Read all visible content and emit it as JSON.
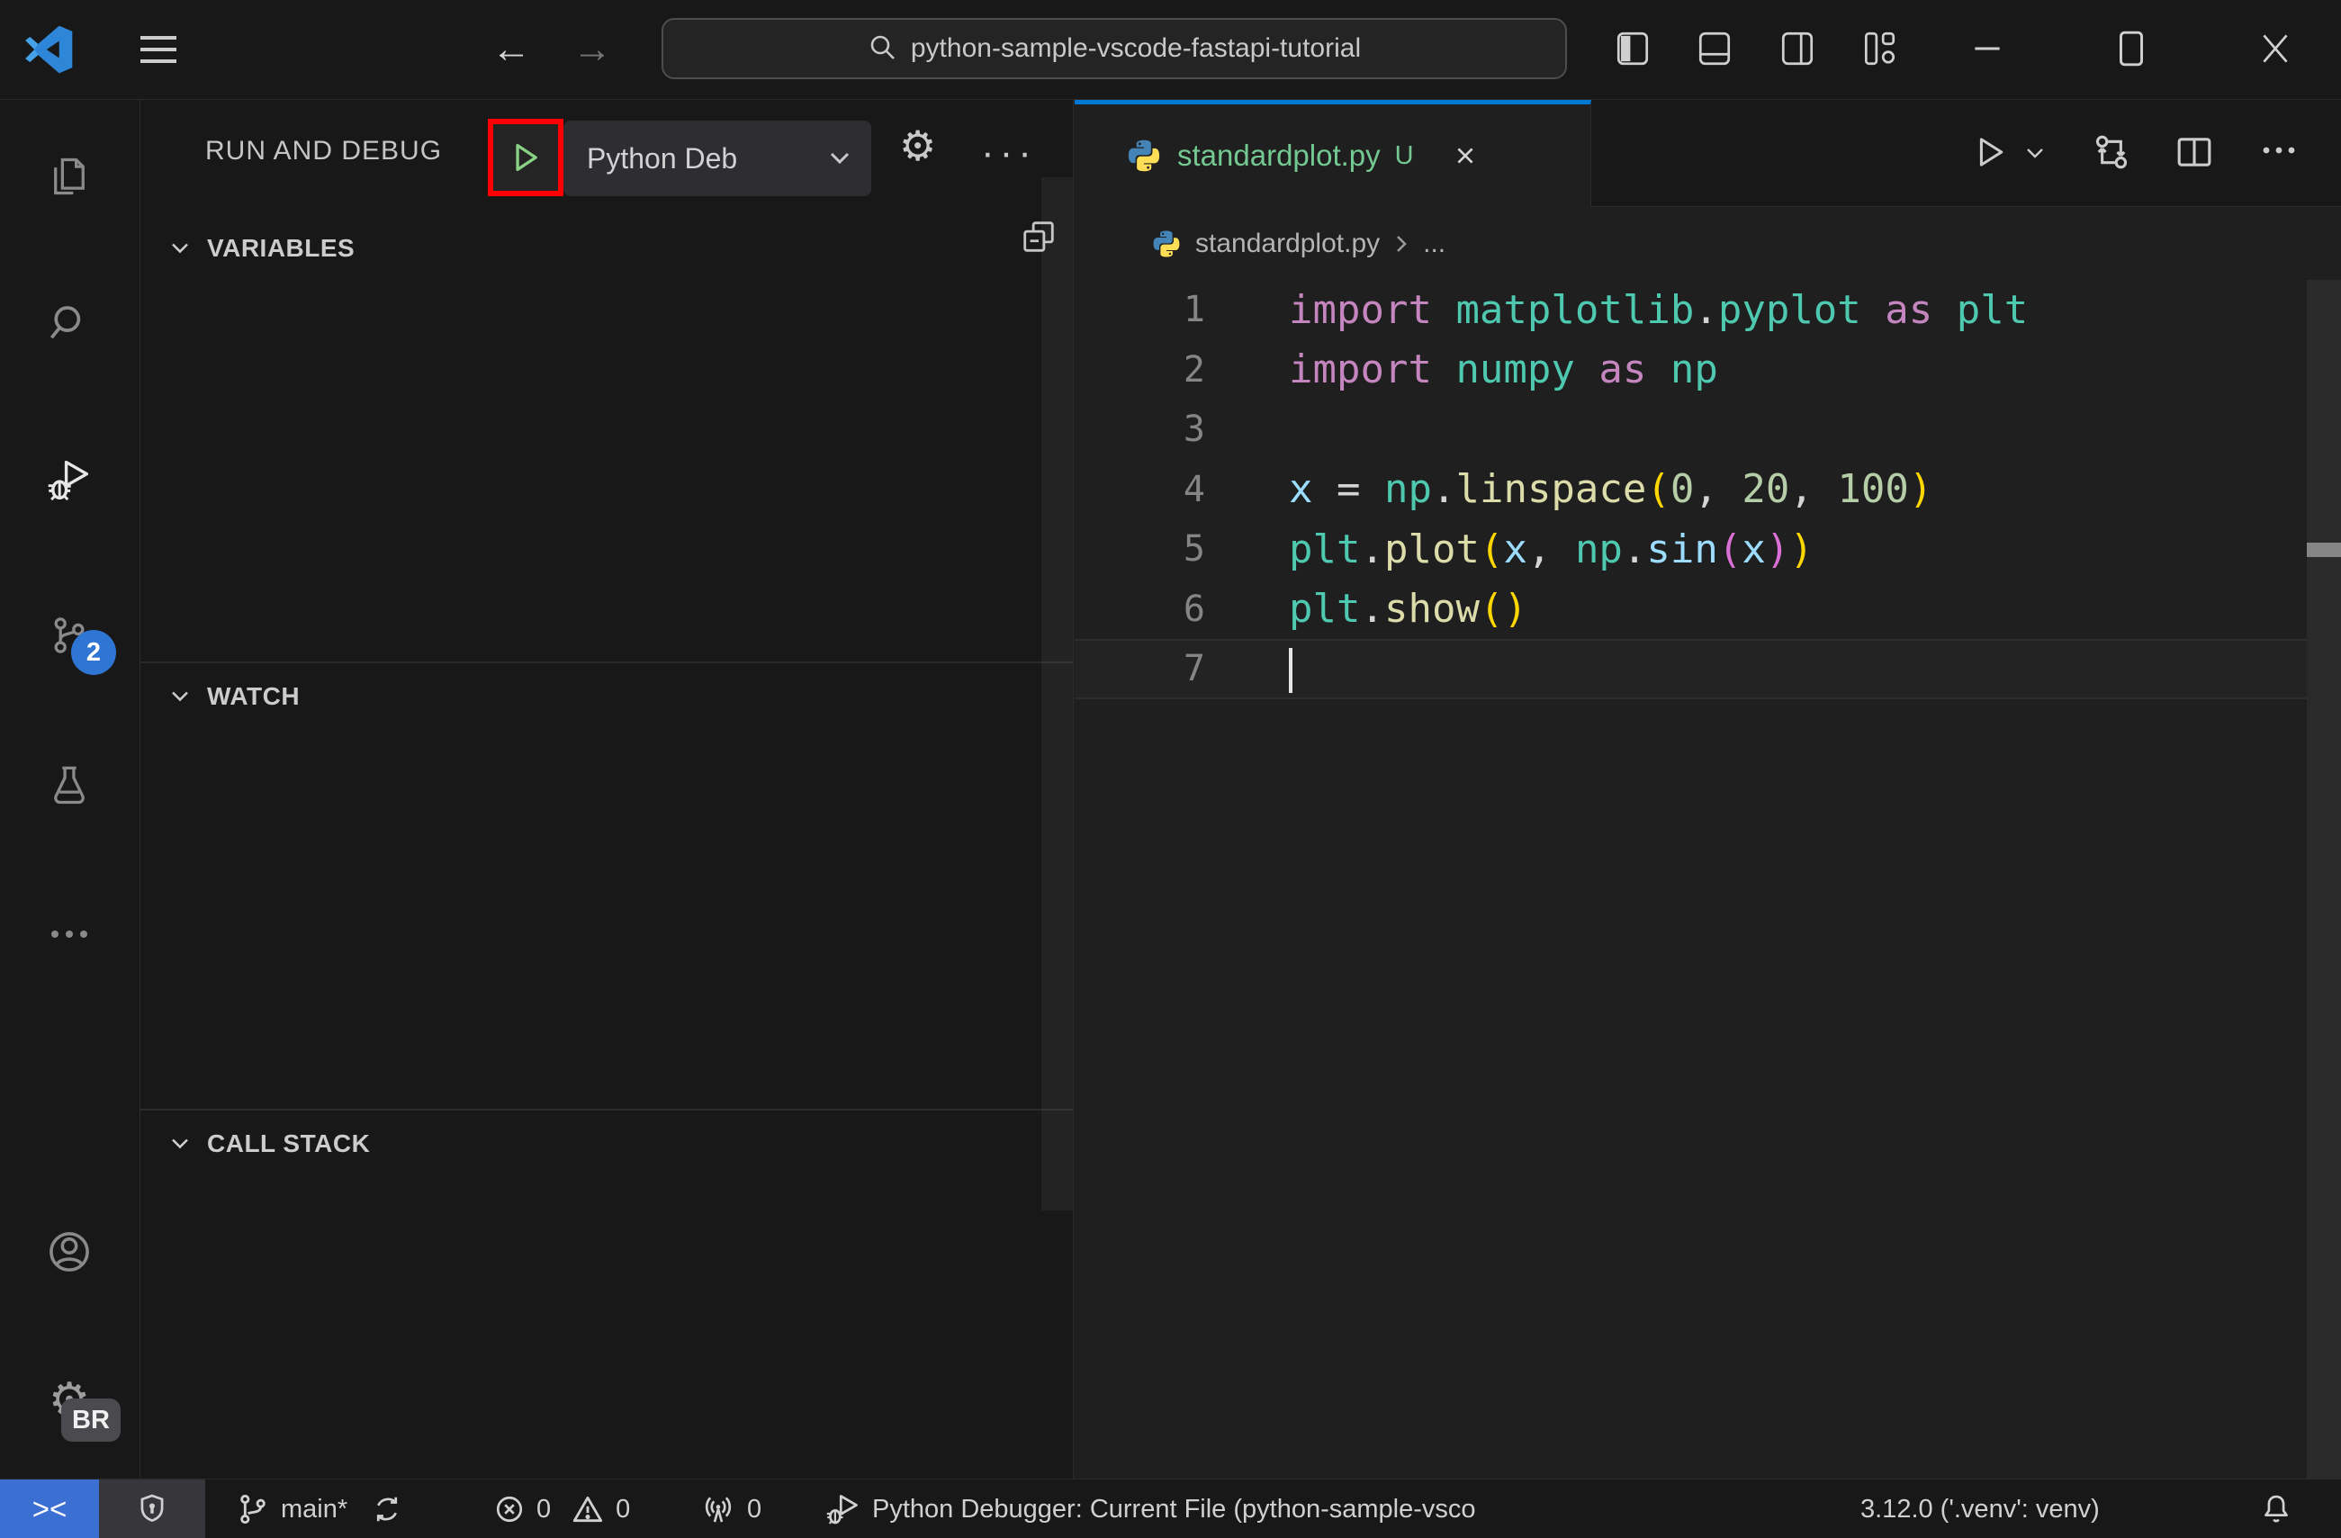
{
  "colors": {
    "accent_blue": "#0078D4",
    "badge_blue": "#2F76D4",
    "remote_blue": "#3C6FD2",
    "untracked_green": "#73C991",
    "play_green": "#89D185",
    "highlight_red": "#FF0000",
    "editor_bg": "#1F1F1F",
    "chrome_bg": "#181818"
  },
  "icons": {
    "gear_glyph": "⚙"
  },
  "title_bar": {
    "search_value": "python-sample-vscode-fastapi-tutorial"
  },
  "activity_bar": {
    "scm_badge": "2",
    "profile_badge": "BR"
  },
  "sidebar": {
    "title": "RUN AND DEBUG",
    "config_name": "Python Deb",
    "sections": [
      {
        "label": "VARIABLES"
      },
      {
        "label": "WATCH"
      },
      {
        "label": "CALL STACK"
      }
    ]
  },
  "editor": {
    "tab": {
      "file_name": "standardplot.py",
      "modified_indicator": "U"
    },
    "breadcrumb": {
      "file_name": "standardplot.py",
      "symbol": "..."
    },
    "code": {
      "active_line": 7,
      "token_colors": {
        "kw": "#C586C0",
        "ns": "#4EC9B0",
        "fn": "#DCDCAA",
        "var": "#9CDCFE",
        "num": "#B5CEA8",
        "pl": "#D4D4D4",
        "b1": "#FFD700",
        "b2": "#DA70D6"
      },
      "lines": [
        [
          {
            "t": "import ",
            "c": "kw"
          },
          {
            "t": "matplotlib",
            "c": "ns"
          },
          {
            "t": ".",
            "c": "pl"
          },
          {
            "t": "pyplot",
            "c": "ns"
          },
          {
            "t": " as ",
            "c": "kw"
          },
          {
            "t": "plt",
            "c": "ns"
          }
        ],
        [
          {
            "t": "import ",
            "c": "kw"
          },
          {
            "t": "numpy",
            "c": "ns"
          },
          {
            "t": " as ",
            "c": "kw"
          },
          {
            "t": "np",
            "c": "ns"
          }
        ],
        [],
        [
          {
            "t": "x",
            "c": "var"
          },
          {
            "t": " = ",
            "c": "pl"
          },
          {
            "t": "np",
            "c": "ns"
          },
          {
            "t": ".",
            "c": "pl"
          },
          {
            "t": "linspace",
            "c": "fn"
          },
          {
            "t": "(",
            "c": "b1"
          },
          {
            "t": "0",
            "c": "num"
          },
          {
            "t": ", ",
            "c": "pl"
          },
          {
            "t": "20",
            "c": "num"
          },
          {
            "t": ", ",
            "c": "pl"
          },
          {
            "t": "100",
            "c": "num"
          },
          {
            "t": ")",
            "c": "b1"
          }
        ],
        [
          {
            "t": "plt",
            "c": "ns"
          },
          {
            "t": ".",
            "c": "pl"
          },
          {
            "t": "plot",
            "c": "fn"
          },
          {
            "t": "(",
            "c": "b1"
          },
          {
            "t": "x",
            "c": "var"
          },
          {
            "t": ", ",
            "c": "pl"
          },
          {
            "t": "np",
            "c": "ns"
          },
          {
            "t": ".",
            "c": "pl"
          },
          {
            "t": "sin",
            "c": "var"
          },
          {
            "t": "(",
            "c": "b2"
          },
          {
            "t": "x",
            "c": "var"
          },
          {
            "t": ")",
            "c": "b2"
          },
          {
            "t": ")",
            "c": "b1"
          }
        ],
        [
          {
            "t": "plt",
            "c": "ns"
          },
          {
            "t": ".",
            "c": "pl"
          },
          {
            "t": "show",
            "c": "fn"
          },
          {
            "t": "()",
            "c": "b1"
          }
        ],
        []
      ]
    }
  },
  "status_bar": {
    "remote_label": "><",
    "branch": "main*",
    "errors": "0",
    "warnings": "0",
    "ports": "0",
    "debug_status": "Python Debugger: Current File (python-sample-vsco",
    "interpreter": "3.12.0 ('.venv': venv)"
  }
}
